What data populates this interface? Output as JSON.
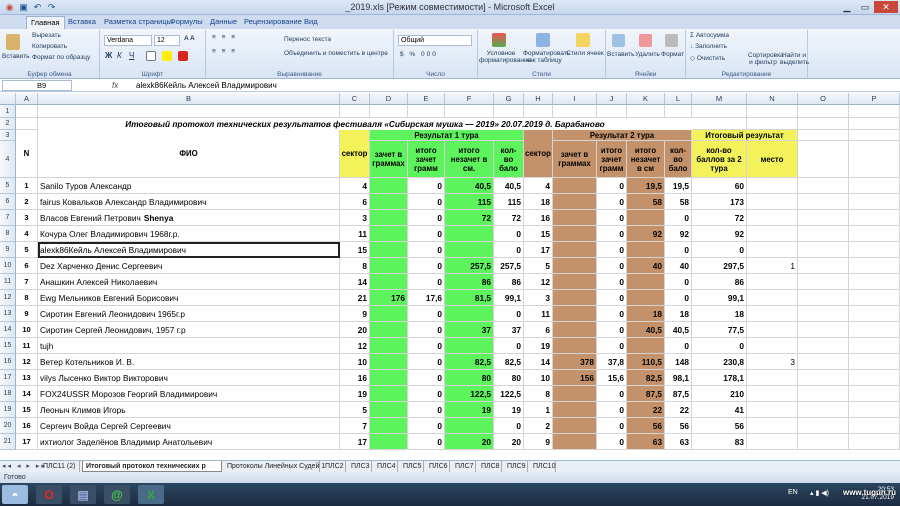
{
  "window": {
    "title": "_2019.xls  [Режим совместимости]  -  Microsoft Excel"
  },
  "tabs": [
    "Главная",
    "Вставка",
    "Разметка страницы",
    "Формулы",
    "Данные",
    "Рецензирование",
    "Вид"
  ],
  "ribbon": {
    "clipboard": {
      "paste": "Вставить",
      "cut": "Вырезать",
      "copy": "Копировать",
      "format_painter": "Формат по образцу",
      "label": "Буфер обмена"
    },
    "font": {
      "name": "Verdana",
      "size": "12",
      "label": "Шрифт"
    },
    "alignment": {
      "wrap": "Перенос текста",
      "merge": "Объединить и поместить в центре",
      "label": "Выравнивание"
    },
    "number": {
      "format": "Общий",
      "label": "Число"
    },
    "styles": {
      "conditional": "Условное форматирование",
      "as_table": "Форматировать как таблицу",
      "cell_styles": "Стили ячеек",
      "label": "Стили"
    },
    "cells": {
      "insert": "Вставить",
      "delete": "Удалить",
      "format": "Формат",
      "label": "Ячейки"
    },
    "editing": {
      "autosum": "Автосумма",
      "fill": "Заполнить",
      "clear": "Очистить",
      "sort": "Сортировка и фильтр",
      "find": "Найти и выделить",
      "label": "Редактирование"
    }
  },
  "formula_bar": {
    "cell_ref": "B9",
    "fx": "fx",
    "value": "alexk86Кейль Алексей Владимирович"
  },
  "columns": [
    "A",
    "B",
    "C",
    "D",
    "E",
    "F",
    "G",
    "H",
    "I",
    "J",
    "K",
    "L",
    "M",
    "N",
    "O",
    "P"
  ],
  "sheet": {
    "title": "Итоговый протокол технических результатов фестиваля «Сибирская мушка — 2019» 20.07.2019 д. Барабаново",
    "header": {
      "n": "N",
      "fio": "ФИО",
      "sector": "сектор",
      "r1": "Результат 1 тура",
      "r2": "Результат 2 тура",
      "total": "Итоговый результат",
      "zachet": "зачет в граммах",
      "itogo_zachet": "итого зачет грамм",
      "itogo_nezachet": "итого незачет в см.",
      "kolvo": "кол-во бало",
      "sector2": "сектор",
      "zachet2": "зачет в граммах",
      "itogo_zachet2": "итого зачет грамм",
      "itogo_nezachet2": "итого незачет в см",
      "kolvo2": "кол-во бало",
      "kolvo_total": "кол-во баллов за 2 тура",
      "mesto": "место"
    },
    "rows": [
      {
        "r": "5",
        "n": "1",
        "fio": "Sanilo Туров Александр",
        "c": "4",
        "d": "",
        "e": "0",
        "f": "40,5",
        "g": "40,5",
        "h": "4",
        "i": "",
        "j": "0",
        "k": "19,5",
        "l": "19,5",
        "m": "60",
        "nn": ""
      },
      {
        "r": "6",
        "n": "2",
        "fio": "fairus Ковальков Александр Владимирович",
        "c": "6",
        "d": "",
        "e": "0",
        "f": "115",
        "g": "115",
        "h": "18",
        "i": "",
        "j": "0",
        "k": "58",
        "l": "58",
        "m": "173",
        "nn": ""
      },
      {
        "r": "7",
        "n": "3",
        "fio": "Власов Евгений Петрович",
        "fio_bold": "Shenya",
        "c": "3",
        "d": "",
        "e": "0",
        "f": "72",
        "g": "72",
        "h": "16",
        "i": "",
        "j": "0",
        "k": "",
        "l": "0",
        "m": "72",
        "nn": ""
      },
      {
        "r": "8",
        "n": "4",
        "fio": "Кочура Олег Владимирович 1968г.р.",
        "c": "11",
        "d": "",
        "e": "0",
        "f": "",
        "g": "0",
        "h": "15",
        "i": "",
        "j": "0",
        "k": "92",
        "l": "92",
        "m": "92",
        "nn": ""
      },
      {
        "r": "9",
        "n": "5",
        "fio": "alexk86Кейль Алексей Владимирович",
        "c": "15",
        "d": "",
        "e": "0",
        "f": "",
        "g": "0",
        "h": "17",
        "i": "",
        "j": "0",
        "k": "",
        "l": "0",
        "m": "0",
        "nn": ""
      },
      {
        "r": "10",
        "n": "6",
        "fio": "Dez Харченко Денис Сергеевич",
        "c": "8",
        "d": "",
        "e": "0",
        "f": "257,5",
        "g": "257,5",
        "h": "5",
        "i": "",
        "j": "0",
        "k": "40",
        "l": "40",
        "m": "297,5",
        "nn": "1"
      },
      {
        "r": "11",
        "n": "7",
        "fio": "Анашкин Алексей Николаевич",
        "c": "14",
        "d": "",
        "e": "0",
        "f": "86",
        "g": "86",
        "h": "12",
        "i": "",
        "j": "0",
        "k": "",
        "l": "0",
        "m": "86",
        "nn": ""
      },
      {
        "r": "12",
        "n": "8",
        "fio": "Ewg Мельников Евгений Борисович",
        "c": "21",
        "d": "176",
        "e": "17,6",
        "f": "81,5",
        "g": "99,1",
        "h": "3",
        "i": "",
        "j": "0",
        "k": "",
        "l": "0",
        "m": "99,1",
        "nn": ""
      },
      {
        "r": "13",
        "n": "9",
        "fio": "Сиротин Евгений Леонидович 1965г.р",
        "c": "9",
        "d": "",
        "e": "0",
        "f": "",
        "g": "0",
        "h": "11",
        "i": "",
        "j": "0",
        "k": "18",
        "l": "18",
        "m": "18",
        "nn": ""
      },
      {
        "r": "14",
        "n": "10",
        "fio": "Сиротин Сергей Леонидович, 1957 г.р",
        "c": "20",
        "d": "",
        "e": "0",
        "f": "37",
        "g": "37",
        "h": "6",
        "i": "",
        "j": "0",
        "k": "40,5",
        "l": "40,5",
        "m": "77,5",
        "nn": ""
      },
      {
        "r": "15",
        "n": "11",
        "fio": "tujh",
        "c": "12",
        "d": "",
        "e": "0",
        "f": "",
        "g": "0",
        "h": "19",
        "i": "",
        "j": "0",
        "k": "",
        "l": "0",
        "m": "0",
        "nn": ""
      },
      {
        "r": "16",
        "n": "12",
        "fio": "Ветер Котельников И. В.",
        "c": "10",
        "d": "",
        "e": "0",
        "f": "82,5",
        "g": "82,5",
        "h": "14",
        "i": "378",
        "j": "37,8",
        "k": "110,5",
        "l": "148",
        "m": "230,8",
        "nn": "3"
      },
      {
        "r": "17",
        "n": "13",
        "fio": "vilys Лысенко Виктор Викторович",
        "c": "16",
        "d": "",
        "e": "0",
        "f": "80",
        "g": "80",
        "h": "10",
        "i": "156",
        "j": "15,6",
        "k": "82,5",
        "l": "98,1",
        "m": "178,1",
        "nn": ""
      },
      {
        "r": "18",
        "n": "14",
        "fio": "FOX24USSR Морозов Георгий Владимирович",
        "c": "19",
        "d": "",
        "e": "0",
        "f": "122,5",
        "g": "122,5",
        "h": "8",
        "i": "",
        "j": "0",
        "k": "87,5",
        "l": "87,5",
        "m": "210",
        "nn": ""
      },
      {
        "r": "19",
        "n": "15",
        "fio": "Леоныч Климов Игорь",
        "c": "5",
        "d": "",
        "e": "0",
        "f": "19",
        "g": "19",
        "h": "1",
        "i": "",
        "j": "0",
        "k": "22",
        "l": "22",
        "m": "41",
        "nn": ""
      },
      {
        "r": "20",
        "n": "16",
        "fio": "Сергеич Войда Сергей Сергеевич",
        "c": "7",
        "d": "",
        "e": "0",
        "f": "",
        "g": "0",
        "h": "2",
        "i": "",
        "j": "0",
        "k": "56",
        "l": "56",
        "m": "56",
        "nn": ""
      },
      {
        "r": "21",
        "n": "17",
        "fio": "ихтиолог Заделёнов Владимир Анатольевич",
        "c": "17",
        "d": "",
        "e": "0",
        "f": "20",
        "g": "20",
        "h": "9",
        "i": "",
        "j": "0",
        "k": "63",
        "l": "63",
        "m": "83",
        "nn": ""
      }
    ]
  },
  "sheet_tabs": [
    "ПЛС11 (2)",
    "Итоговый протокол технических р",
    "Протоколы Линейных Судей 1",
    "ПЛС2",
    "ПЛС3",
    "ПЛС4",
    "ПЛС5",
    "ПЛС6",
    "ПЛС7",
    "ПЛС8",
    "ПЛС9",
    "ПЛС10"
  ],
  "status": "Готово",
  "taskbar": {
    "lang": "EN",
    "time": "20:53",
    "date": "21.07.2019"
  },
  "watermark": "www.tugun.ru"
}
